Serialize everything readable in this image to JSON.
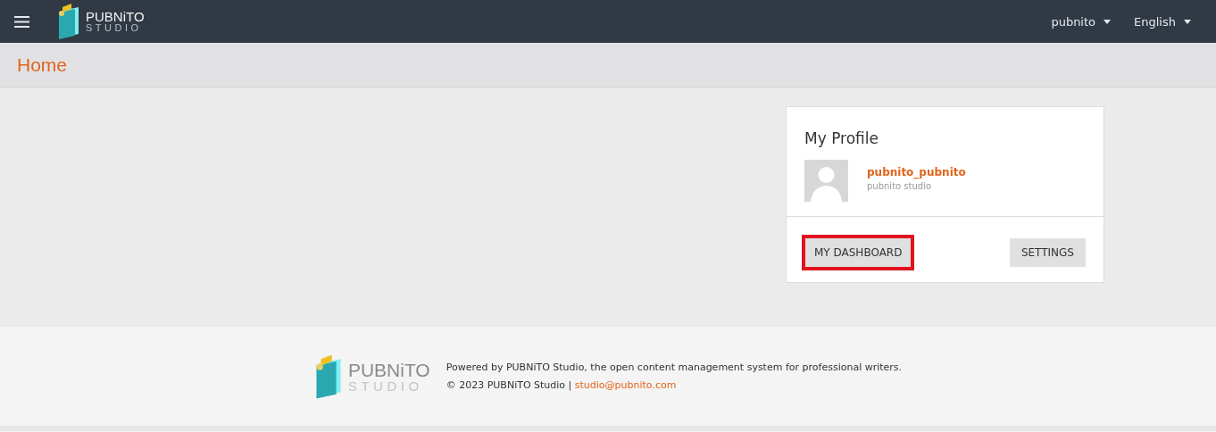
{
  "header": {
    "logo": {
      "name": "PUBNiTO",
      "sub": "STUDIO"
    },
    "menus": [
      {
        "label": "pubnito"
      },
      {
        "label": "English"
      }
    ]
  },
  "page_title": "Home",
  "profile_card": {
    "title": "My Profile",
    "username": "pubnito_pubnito",
    "subtitle": "pubnito studio",
    "buttons": [
      {
        "label": "MY DASHBOARD",
        "highlighted": true
      },
      {
        "label": "SETTINGS",
        "highlighted": false
      }
    ]
  },
  "footer": {
    "logo": {
      "name": "PUBNiTO",
      "sub": "STUDIO"
    },
    "tagline": "Powered by PUBNiTO Studio, the open content management system for professional writers.",
    "copyright": "© 2023 PUBNiTO Studio | ",
    "email": "studio@pubnito.com"
  }
}
